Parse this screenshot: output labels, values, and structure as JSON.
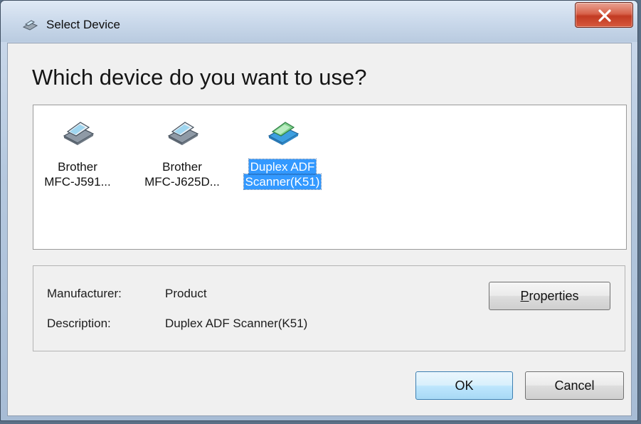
{
  "window": {
    "title": "Select Device",
    "close_glyph": "✕"
  },
  "heading": "Which device do you want to use?",
  "devices": [
    {
      "line1": "Brother",
      "line2": "MFC-J591...",
      "icon": "scanner-icon",
      "selected": false
    },
    {
      "line1": "Brother",
      "line2": "MFC-J625D...",
      "icon": "scanner-icon",
      "selected": false
    },
    {
      "line1": "Duplex ADF",
      "line2": "Scanner(K51)",
      "icon": "scanner-icon",
      "selected": true
    }
  ],
  "info": {
    "manufacturer_label": "Manufacturer:",
    "manufacturer_value": "Product",
    "description_label": "Description:",
    "description_value": "Duplex ADF Scanner(K51)"
  },
  "buttons": {
    "properties_mnemonic": "P",
    "properties_rest": "roperties",
    "ok": "OK",
    "cancel": "Cancel"
  },
  "colors": {
    "selection": "#3399ff",
    "close_button": "#c23a22"
  }
}
